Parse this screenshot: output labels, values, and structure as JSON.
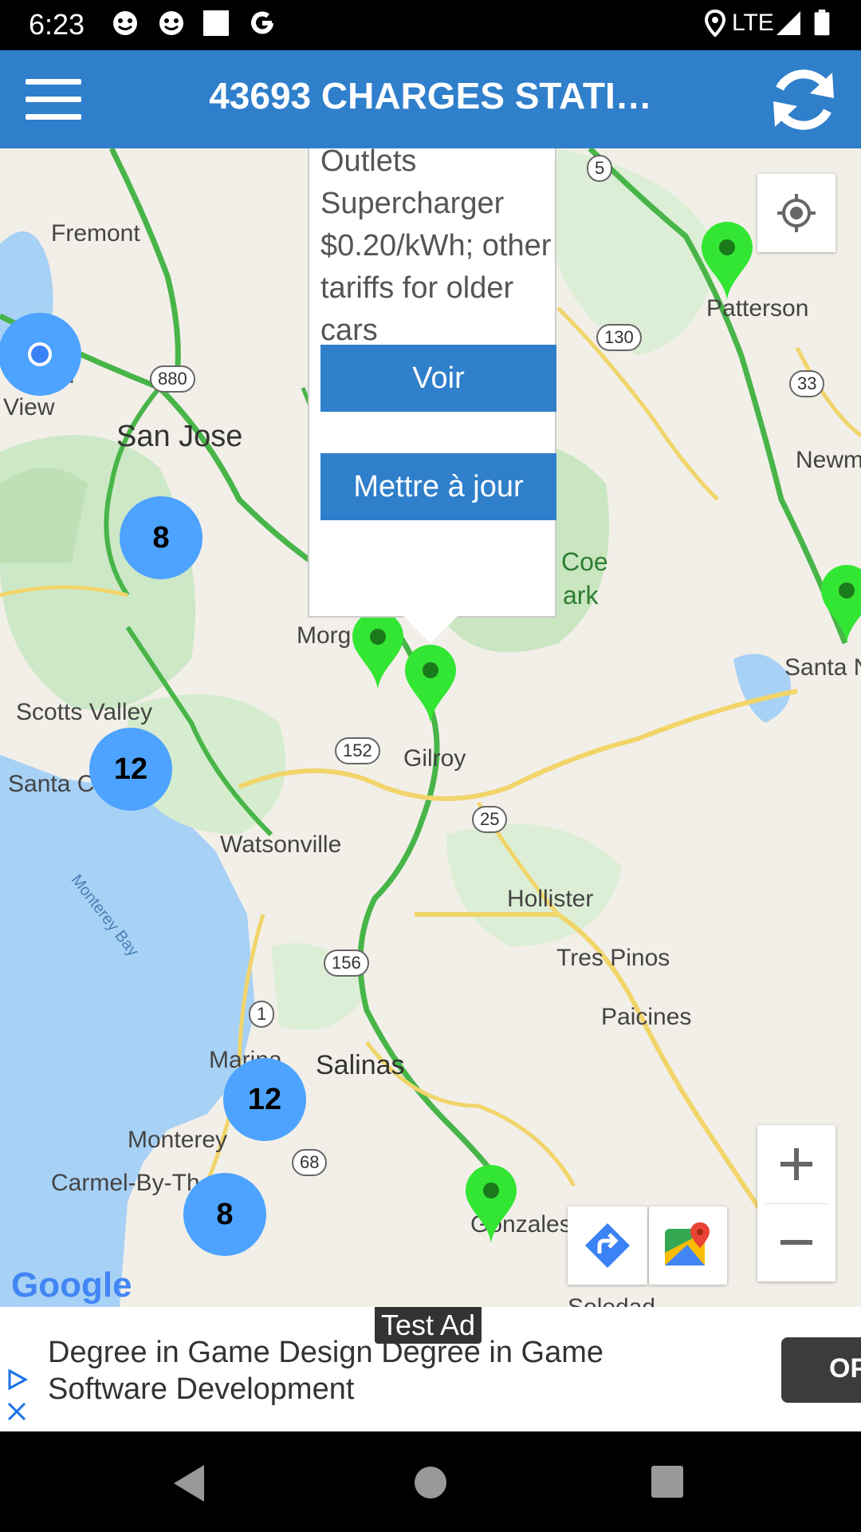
{
  "status": {
    "time": "6:23",
    "network": "LTE"
  },
  "appbar": {
    "title": "43693 CHARGES STATI…"
  },
  "popup": {
    "text": "Outlets Supercharger $0.20/kWh; other tariffs for older cars",
    "view_label": "Voir",
    "update_label": "Mettre à jour"
  },
  "clusters": [
    "8",
    "12",
    "12",
    "8"
  ],
  "map": {
    "places": {
      "fremont": "Fremont",
      "san_jose": "San Jose",
      "view": "View",
      "in": "in",
      "scotts_valley": "Scotts Valley",
      "santa_cruz": "Santa C",
      "watsonville": "Watsonville",
      "gilroy": "Gilroy",
      "morgan_hill": "Morg",
      "coe": "Coe",
      "ark": "ark",
      "hollister": "Hollister",
      "tres_pinos": "Tres Pinos",
      "paicines": "Paicines",
      "salinas": "Salinas",
      "marina": "Marina",
      "monterey": "Monterey",
      "carmel": "Carmel-By-Th",
      "gonzales": "Gonzales",
      "soledad": "Soledad",
      "patterson": "Patterson",
      "newman": "Newm",
      "santa_n": "Santa N",
      "monterey_bay": "Monterey Bay"
    },
    "shields": {
      "r880": "880",
      "r5": "5",
      "r130": "130",
      "r33": "33",
      "r152": "152",
      "r25": "25",
      "r156": "156",
      "r1": "1",
      "r68": "68"
    },
    "google": "Google"
  },
  "ad": {
    "badge": "Test Ad",
    "text": "Degree in Game Design Degree in Game Software Development",
    "cta": "OPEN"
  },
  "colors": {
    "accent": "#2f7fcb",
    "cluster": "#4da3ff",
    "pin": "#33e633"
  }
}
